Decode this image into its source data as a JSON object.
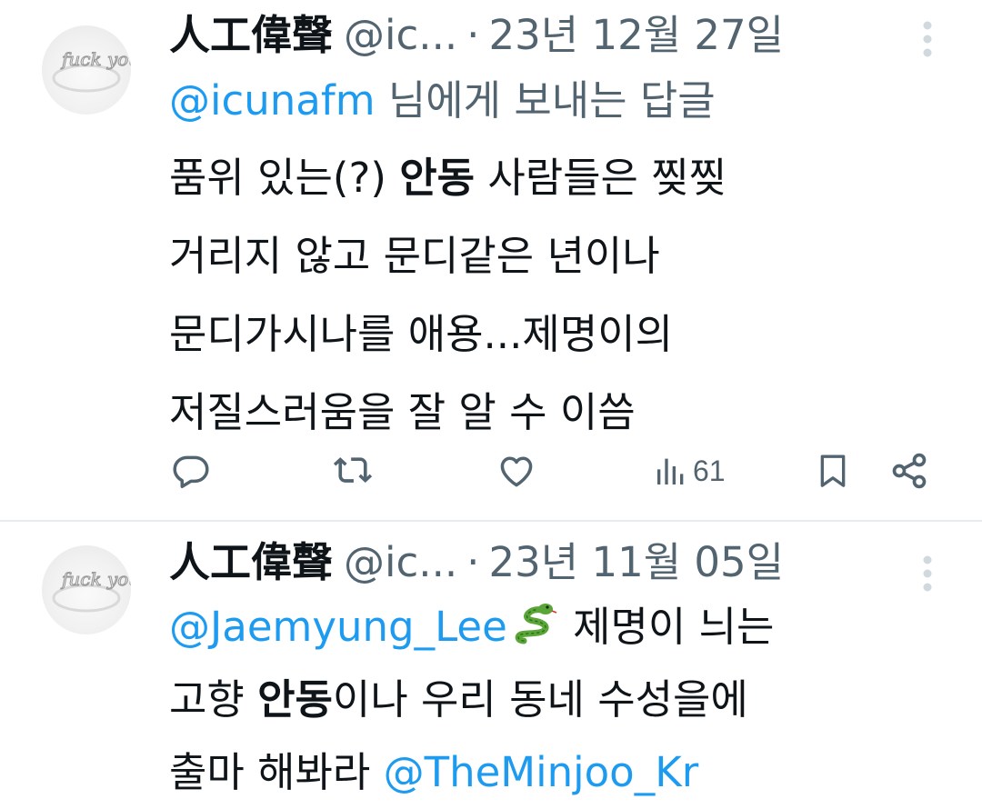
{
  "tweets": [
    {
      "author": {
        "display_name": "人工偉聲",
        "handle": "@ic...",
        "avatar_text": "fuck you"
      },
      "separator": "·",
      "date": "23년 12월 27일",
      "reply_to": {
        "mention": "@icunafm",
        "suffix": " 님에게 보내는 답글"
      },
      "body": {
        "line1_a": "품위 있는(?) ",
        "line1_bold": "안동",
        "line1_b": " 사람들은 찢찢",
        "line2": "거리지  않고 문디같은 년이나",
        "line3": "문디가시나를 애용...제명이의",
        "line4": "저질스러움을 잘 알 수 이씀"
      },
      "actions": {
        "reply_icon": "reply-icon",
        "retweet_icon": "retweet-icon",
        "like_icon": "like-icon",
        "views_icon": "views-icon",
        "views_count": "61",
        "bookmark_icon": "bookmark-icon",
        "share_icon": "share-icon"
      }
    },
    {
      "author": {
        "display_name": "人工偉聲",
        "handle": "@ic...",
        "avatar_text": "fuck you"
      },
      "separator": "·",
      "date": "23년 11월 05일",
      "body": {
        "mention1": "@Jaemyung_Lee",
        "emoji": "snake-emoji",
        "line1_rest": " 제명이 늬는",
        "line2_a": "고향 ",
        "line2_bold": "안동",
        "line2_b": "이나 우리 동네 수성을에",
        "line3_a": "출마 해봐라 ",
        "mention2": "@TheMinjoo_Kr"
      }
    }
  ],
  "colors": {
    "text": "#0f1419",
    "secondary": "#536471",
    "link": "#1d9bf0",
    "divider": "#e8ecef"
  }
}
